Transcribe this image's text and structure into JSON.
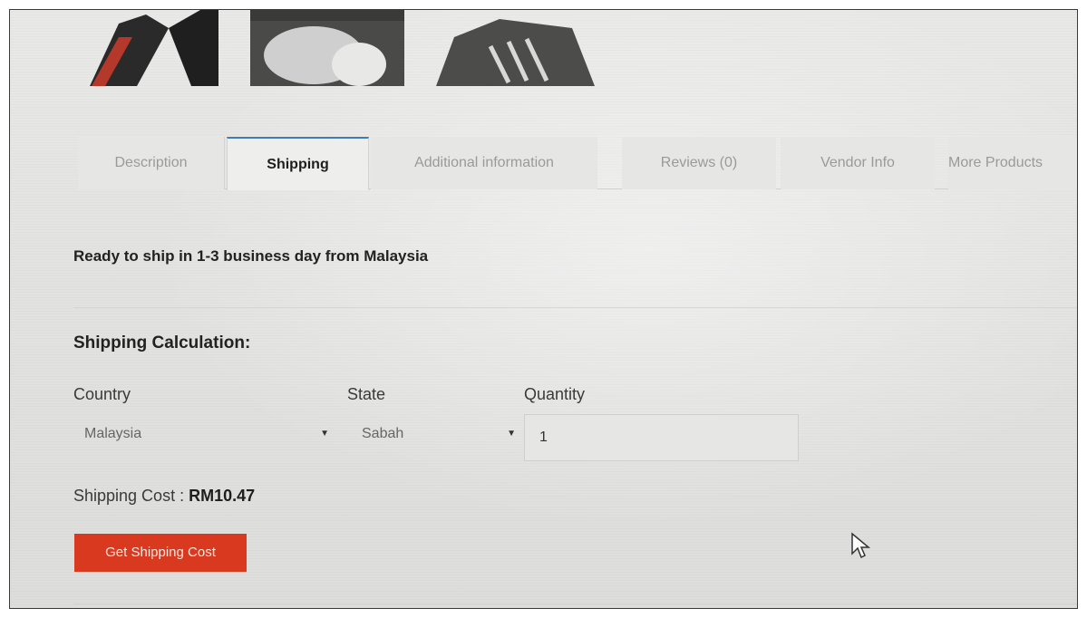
{
  "tabs": [
    {
      "label": "Description",
      "active": false
    },
    {
      "label": "Shipping",
      "active": true
    },
    {
      "label": "Additional information",
      "active": false
    },
    {
      "label": "Reviews (0)",
      "active": false
    },
    {
      "label": "Vendor Info",
      "active": false
    },
    {
      "label": "More Products",
      "active": false
    }
  ],
  "shipping": {
    "ready_text": "Ready to ship in 1-3 business day from Malaysia",
    "calc_title": "Shipping Calculation:",
    "country_label": "Country",
    "state_label": "State",
    "quantity_label": "Quantity",
    "country_value": "Malaysia",
    "state_value": "Sabah",
    "quantity_value": "1",
    "cost_label": "Shipping Cost : ",
    "cost_value": "RM10.47",
    "button_label": "Get Shipping Cost"
  },
  "colors": {
    "active_tab_border": "#3d7dbf",
    "button_bg": "#d93a1f"
  },
  "icons": {
    "dropdown": "caret-down-icon",
    "cursor": "mouse-pointer-icon"
  }
}
